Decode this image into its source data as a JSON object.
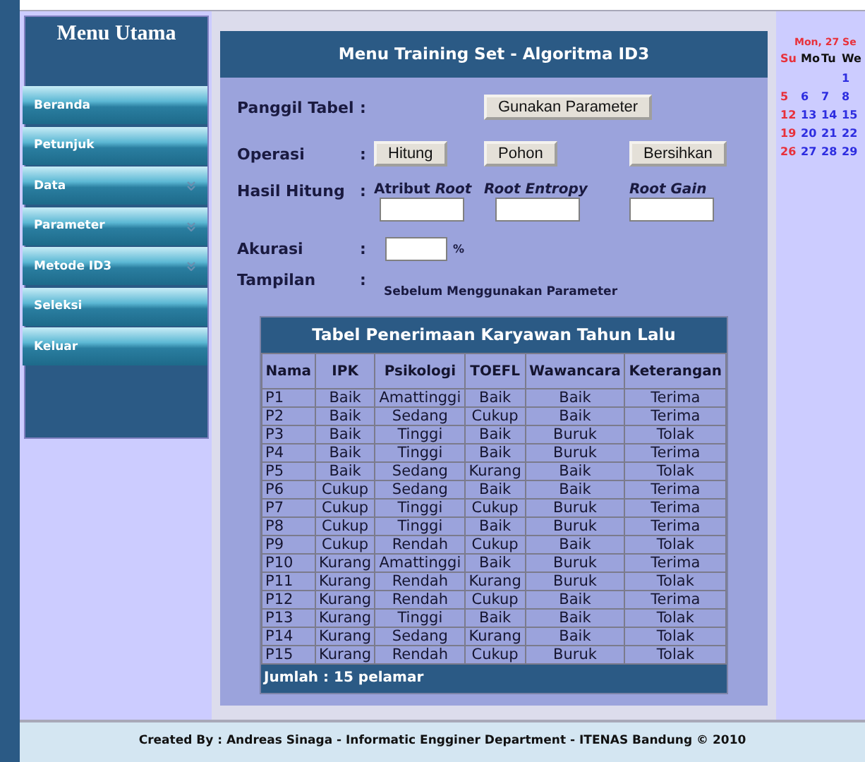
{
  "sidebar": {
    "title": "Menu Utama",
    "items": [
      {
        "label": "Beranda",
        "has_submenu": false
      },
      {
        "label": "Petunjuk",
        "has_submenu": false
      },
      {
        "label": "Data",
        "has_submenu": true
      },
      {
        "label": "Parameter",
        "has_submenu": true
      },
      {
        "label": "Metode ID3",
        "has_submenu": true
      },
      {
        "label": "Seleksi",
        "has_submenu": false
      },
      {
        "label": "Keluar",
        "has_submenu": false
      }
    ]
  },
  "panel": {
    "title": "Menu Training Set - Algoritma ID3"
  },
  "form": {
    "call_table": {
      "label": "Panggil Tabel",
      "colon": ":",
      "button": "Gunakan Parameter"
    },
    "operation": {
      "label": "Operasi",
      "colon": ":",
      "buttons": [
        "Hitung",
        "Pohon",
        "Bersihkan"
      ]
    },
    "results": {
      "label": "Hasil Hitung",
      "colon": ":",
      "fields": [
        {
          "label": "Atribut *Root*",
          "italic": false
        },
        {
          "label": "Root Entropy",
          "italic": true
        },
        {
          "label": "Root Gain",
          "italic": true
        }
      ]
    },
    "accuracy": {
      "label": "Akurasi",
      "colon": ":",
      "unit": "%"
    },
    "display": {
      "label": "Tampilan",
      "colon": ":",
      "caption": "Sebelum Menggunakan Parameter"
    }
  },
  "table": {
    "title": "Tabel Penerimaan Karyawan Tahun Lalu",
    "columns": [
      "Nama",
      "IPK",
      "Psikologi",
      "TOEFL",
      "Wawancara",
      "Keterangan"
    ],
    "rows": [
      [
        "P1",
        "Baik",
        "Amattinggi",
        "Baik",
        "Baik",
        "Terima"
      ],
      [
        "P2",
        "Baik",
        "Sedang",
        "Cukup",
        "Baik",
        "Terima"
      ],
      [
        "P3",
        "Baik",
        "Tinggi",
        "Baik",
        "Buruk",
        "Tolak"
      ],
      [
        "P4",
        "Baik",
        "Tinggi",
        "Baik",
        "Buruk",
        "Terima"
      ],
      [
        "P5",
        "Baik",
        "Sedang",
        "Kurang",
        "Baik",
        "Tolak"
      ],
      [
        "P6",
        "Cukup",
        "Sedang",
        "Baik",
        "Baik",
        "Terima"
      ],
      [
        "P7",
        "Cukup",
        "Tinggi",
        "Cukup",
        "Buruk",
        "Terima"
      ],
      [
        "P8",
        "Cukup",
        "Tinggi",
        "Baik",
        "Buruk",
        "Terima"
      ],
      [
        "P9",
        "Cukup",
        "Rendah",
        "Cukup",
        "Baik",
        "Tolak"
      ],
      [
        "P10",
        "Kurang",
        "Amattinggi",
        "Baik",
        "Buruk",
        "Terima"
      ],
      [
        "P11",
        "Kurang",
        "Rendah",
        "Kurang",
        "Buruk",
        "Tolak"
      ],
      [
        "P12",
        "Kurang",
        "Rendah",
        "Cukup",
        "Baik",
        "Terima"
      ],
      [
        "P13",
        "Kurang",
        "Tinggi",
        "Baik",
        "Baik",
        "Tolak"
      ],
      [
        "P14",
        "Kurang",
        "Sedang",
        "Kurang",
        "Baik",
        "Tolak"
      ],
      [
        "P15",
        "Kurang",
        "Rendah",
        "Cukup",
        "Buruk",
        "Tolak"
      ]
    ],
    "footer": "Jumlah : 15 pelamar"
  },
  "calendar": {
    "heading": "Mon, 27 Se",
    "columns": [
      {
        "label": "Su",
        "color": "#e8303a",
        "days": [
          {
            "day": "5",
            "color": "#e8303a"
          },
          {
            "day": "12",
            "color": "#e8303a"
          },
          {
            "day": "19",
            "color": "#e8303a"
          },
          {
            "day": "26",
            "color": "#e8303a"
          }
        ]
      },
      {
        "label": "Mo",
        "color": "#111111",
        "days": [
          {
            "day": "6",
            "color": "#2d2de0"
          },
          {
            "day": "13",
            "color": "#2d2de0"
          },
          {
            "day": "20",
            "color": "#2d2de0"
          },
          {
            "day": "27",
            "color": "#2d2de0"
          }
        ]
      },
      {
        "label": "Tu",
        "color": "#111111",
        "days": [
          {
            "day": "7",
            "color": "#2d2de0"
          },
          {
            "day": "14",
            "color": "#2d2de0"
          },
          {
            "day": "21",
            "color": "#2d2de0"
          },
          {
            "day": "28",
            "color": "#2d2de0"
          }
        ]
      },
      {
        "label": "We",
        "color": "#111111",
        "days": [
          {
            "day": "1",
            "color": "#2d2de0"
          },
          {
            "day": "8",
            "color": "#2d2de0"
          },
          {
            "day": "15",
            "color": "#2d2de0"
          },
          {
            "day": "22",
            "color": "#2d2de0"
          },
          {
            "day": "29",
            "color": "#2d2de0"
          }
        ]
      }
    ]
  },
  "footer": {
    "text": "Created By : Andreas Sinaga - Informatic Engginer Department - ITENAS Bandung © 2010"
  }
}
